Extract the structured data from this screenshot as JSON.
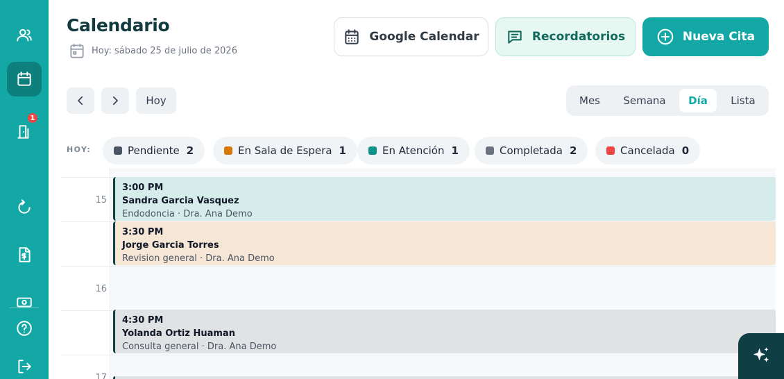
{
  "header": {
    "title": "Calendario",
    "subtitle": "Hoy: sábado 25 de julio de 2026"
  },
  "actions": {
    "google_label": "Google Calendar",
    "reminders_label": "Recordatorios",
    "new_label": "Nueva Cita"
  },
  "navigation": {
    "today_label": "Hoy"
  },
  "views": [
    {
      "label": "Mes",
      "active": false
    },
    {
      "label": "Semana",
      "active": false
    },
    {
      "label": "Día",
      "active": true
    },
    {
      "label": "Lista",
      "active": false
    }
  ],
  "sidebar": {
    "badge": "1"
  },
  "status_summary": {
    "label": "HOY:",
    "items": [
      {
        "label": "Pendiente",
        "count": "2",
        "color": "#4b5563"
      },
      {
        "label": "En Sala de Espera",
        "count": "1",
        "color": "#d97706"
      },
      {
        "label": "En Atención",
        "count": "1",
        "color": "#0d9488"
      },
      {
        "label": "Completada",
        "count": "2",
        "color": "#6b7280"
      },
      {
        "label": "Cancelada",
        "count": "0",
        "color": "#ef4444"
      }
    ]
  },
  "schedule": {
    "hours": [
      "15",
      "16",
      "17"
    ],
    "appointments": [
      {
        "time": "3:00 PM",
        "patient": "Sandra Garcia Vasquez",
        "detail": "Endodoncia · Dra. Ana Demo",
        "color": "#d5ecea"
      },
      {
        "time": "3:30 PM",
        "patient": "Jorge Garcia Torres",
        "detail": "Revision general · Dra. Ana Demo",
        "color": "#f6e6d6"
      },
      {
        "time": "4:30 PM",
        "patient": "Yolanda Ortiz Huaman",
        "detail": "Consulta general · Dra. Ana Demo",
        "color": "#e0e2e4"
      }
    ]
  },
  "colors": {
    "brand": "#13a8a5",
    "brand_dark": "#0f3f45"
  }
}
